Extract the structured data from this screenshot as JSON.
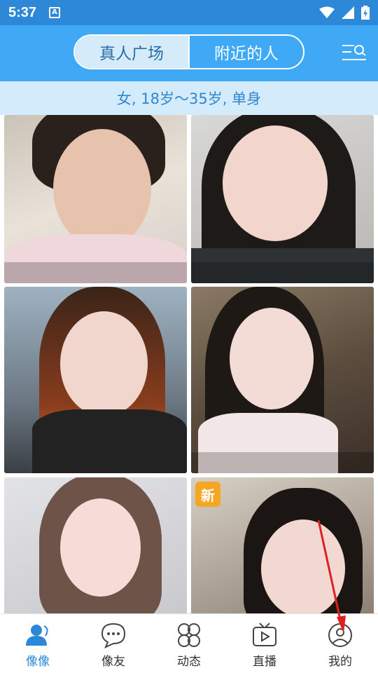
{
  "status_bar": {
    "time": "5:37",
    "notification_icon": "a-letter-icon",
    "icons": [
      "wifi-icon",
      "signal-icon",
      "battery-charging-icon"
    ]
  },
  "header": {
    "tabs": [
      {
        "label": "真人广场",
        "active": true
      },
      {
        "label": "附近的人",
        "active": false
      }
    ],
    "filter_icon": "filter-search-icon"
  },
  "filter": {
    "text": "女, 18岁～35岁, 单身"
  },
  "grid": {
    "cards": [
      {
        "id": 1,
        "badge": ""
      },
      {
        "id": 2,
        "badge": ""
      },
      {
        "id": 3,
        "badge": ""
      },
      {
        "id": 4,
        "badge": ""
      },
      {
        "id": 5,
        "badge": ""
      },
      {
        "id": 6,
        "badge": "新"
      }
    ]
  },
  "tabbar": {
    "items": [
      {
        "label": "像像",
        "icon": "person-icon",
        "active": true
      },
      {
        "label": "像友",
        "icon": "chat-bubble-icon",
        "active": false
      },
      {
        "label": "动态",
        "icon": "moments-icon",
        "active": false
      },
      {
        "label": "直播",
        "icon": "tv-play-icon",
        "active": false
      },
      {
        "label": "我的",
        "icon": "profile-icon",
        "active": false
      }
    ]
  },
  "colors": {
    "primary": "#3fa9f5",
    "status_bar": "#2e88d8",
    "filter_bg": "#d3ebfb",
    "active_tab": "#2b88d9",
    "badge": "#f5a623",
    "annotation_arrow": "#e02020"
  }
}
